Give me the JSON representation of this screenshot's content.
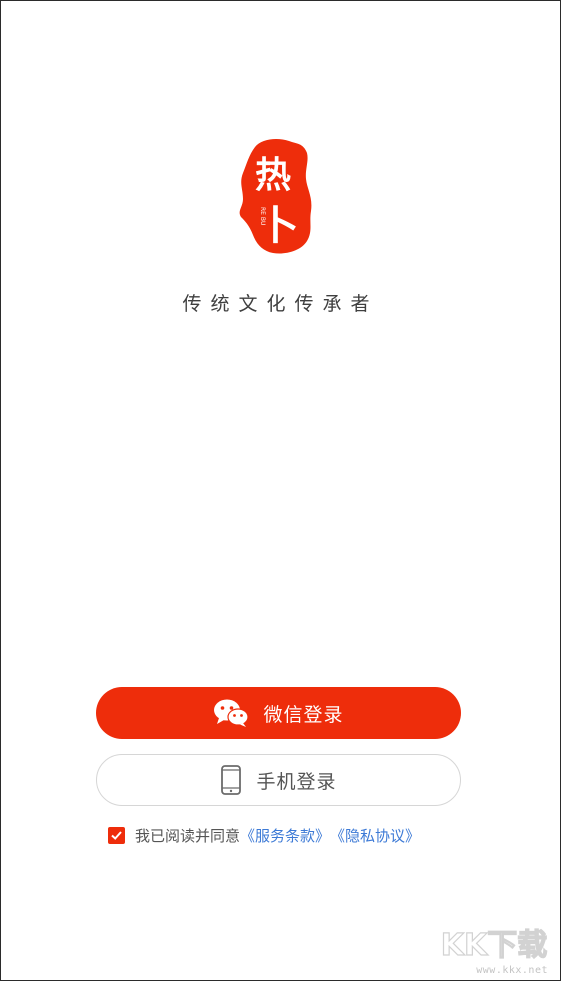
{
  "brand": {
    "logo_char_top": "热",
    "logo_char_bottom": "卜",
    "logo_side_text": "RE BU",
    "tagline": "传统文化传承者",
    "accent_color": "#ee2d0b"
  },
  "buttons": {
    "wechat_login": "微信登录",
    "wechat_icon": "wechat-icon",
    "phone_login": "手机登录",
    "phone_icon": "smartphone-icon"
  },
  "agreement": {
    "checked": true,
    "text": "我已阅读并同意",
    "terms_link": "《服务条款》",
    "privacy_link": "《隐私协议》",
    "link_color": "#3d7ad6"
  },
  "watermark": {
    "mark": "KK下载",
    "url": "www.kkx.net"
  }
}
